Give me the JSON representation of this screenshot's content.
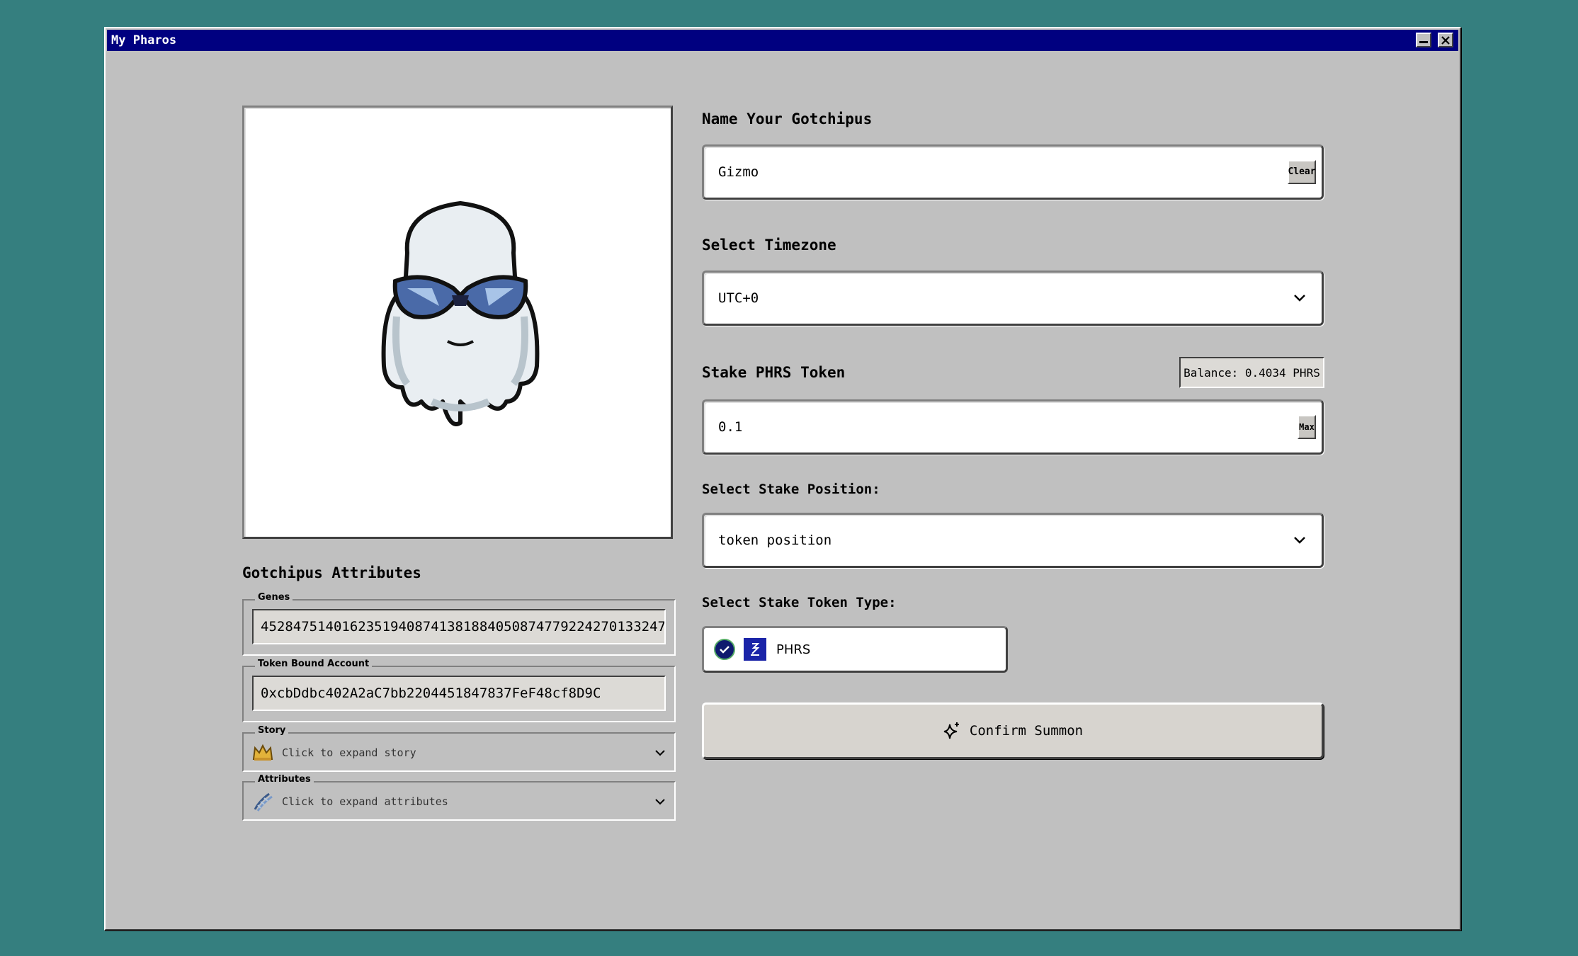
{
  "window": {
    "title": "My Pharos"
  },
  "left": {
    "attributes_heading": "Gotchipus Attributes",
    "genes": {
      "legend": "Genes",
      "value": "45284751401623519408741381884050874779224270133247"
    },
    "tba": {
      "legend": "Token Bound Account",
      "value": "0xcbDdbc402A2aC7bb2204451847837FeF48cf8D9C"
    },
    "story": {
      "legend": "Story",
      "text": "Click to expand story",
      "icon": "crown-icon"
    },
    "attributes": {
      "legend": "Attributes",
      "text": "Click to expand attributes",
      "icon": "dna-icon"
    }
  },
  "right": {
    "name_label": "Name Your Gotchipus",
    "name_value": "Gizmo",
    "clear_label": "Clear",
    "timezone_label": "Select Timezone",
    "timezone_value": "UTC+0",
    "stake_label": "Stake PHRS Token",
    "balance": "Balance: 0.4034 PHRS",
    "stake_value": "0.1",
    "max_label": "Max",
    "position_label": "Select Stake Position:",
    "position_value": "token position",
    "token_type_label": "Select Stake Token Type:",
    "token_name": "PHRS",
    "confirm_label": "Confirm Summon"
  },
  "colors": {
    "desktop": "#357f7f",
    "titlebar": "#000080",
    "window": "#c0c0c0"
  }
}
